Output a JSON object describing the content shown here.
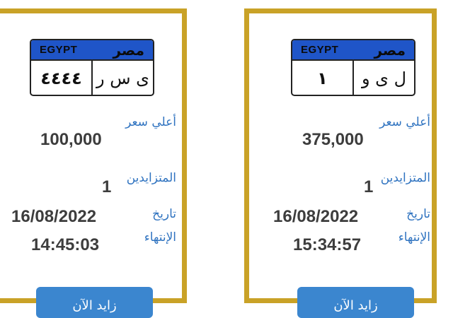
{
  "cards": [
    {
      "plate": {
        "country_en": "EGYPT",
        "country_ar": "مصر",
        "numbers": "٤٤٤٤",
        "letters": "ى س ر"
      },
      "price_label": "أعلي سعر",
      "price": "100,000",
      "bidders_label": "المتزايدين",
      "bidders": "1",
      "date_label": "تاريخ",
      "end_label": "الإنتهاء",
      "end_date": "16/08/2022",
      "end_time": "14:45:03",
      "button_label": "زايد الآن"
    },
    {
      "plate": {
        "country_en": "EGYPT",
        "country_ar": "مصر",
        "numbers": "١",
        "letters": "ل ى و"
      },
      "price_label": "أعلي سعر",
      "price": "375,000",
      "bidders_label": "المتزايدين",
      "bidders": "1",
      "date_label": "تاريخ",
      "end_label": "الإنتهاء",
      "end_date": "16/08/2022",
      "end_time": "15:34:57",
      "button_label": "زايد الآن"
    }
  ]
}
